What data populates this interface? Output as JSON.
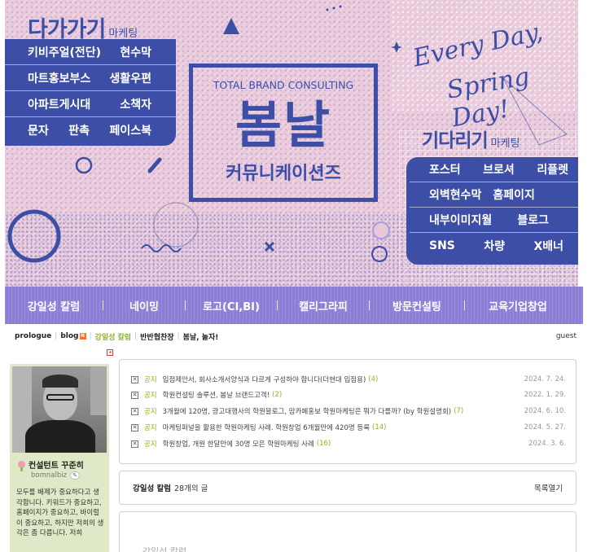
{
  "banner": {
    "left_title": "다가가기",
    "left_sub": "마케팅",
    "left_rows": [
      [
        "키비주얼(전단)",
        "현수막"
      ],
      [
        "마트홍보부스",
        "생활우편"
      ],
      [
        "아파트게시대",
        "소책자"
      ],
      [
        "문자",
        "판촉",
        "페이스북"
      ]
    ],
    "right_title": "기다리기",
    "right_sub": "마케팅",
    "right_rows": [
      [
        "포스터",
        "브로셔",
        "리플렛"
      ],
      [
        "외벽현수막",
        "홈페이지"
      ],
      [
        "내부이미지월",
        "블로그"
      ],
      [
        "SNS",
        "차량",
        "X배너"
      ]
    ],
    "logo_sub": "TOTAL BRAND CONSULTING",
    "logo_main": "봄날",
    "logo_comm": "커뮤니케이션즈",
    "script_line1": "Every Day,",
    "script_line2": "Spring Day!",
    "accent_color": "#3d4ea6",
    "nav": [
      "강일성 칼럼",
      "네이밍",
      "로고(CI,BI)",
      "캘리그라피",
      "방문컨설팅",
      "교육기업창업"
    ]
  },
  "blogmenu": {
    "items": [
      "prologue",
      "blog",
      "강일성 칼럼",
      "반반협찬장",
      "봄날, 놀자!"
    ],
    "new_badge": "N",
    "guest": "guest"
  },
  "profile": {
    "name": "컨설턴트 꾸준히",
    "id": "bomnalbiz",
    "edit": "✎",
    "desc": "모두를 배제가 중요하다고 생각합니다. 키워드가 중요하고, 홈페이지가 중요하고, 바이럴이 중요하고, 하지만 저희의 생각은 좀 다릅니다. 저희"
  },
  "notice": {
    "tag": "공지",
    "rows": [
      {
        "title": "입점제안서, 회사소개서양식과 다르게 구성하야 합니다(더현대 입점용)",
        "count": "(4)",
        "date": "2024. 7. 24."
      },
      {
        "title": "학원컨설팅 솔루션, 봄날 브랜드고객! ",
        "count": "(2)",
        "date": "2022. 1. 29."
      },
      {
        "title": "3개월에 120명, 광고대행사의 학원블로그, 맘카페홍보 학원마케팅은 뭐가 다를까? (by 학원설명회)",
        "count": "(7)",
        "date": "2024. 6. 10."
      },
      {
        "title": "마케팅퍼널을 활용한 학원마케팅 사례. 학원창업 6개월만에 420명 등록",
        "count": "(14)",
        "date": "2024. 5. 27."
      },
      {
        "title": "학원창업, 개원 한달만에 30명 모은 학원마케팅 사례",
        "count": "(16)",
        "date": "2024. 3. 6."
      }
    ]
  },
  "list": {
    "category": "강일성 칼럼",
    "count": "28개의 글",
    "open": "목록열기"
  },
  "post": {
    "title": "강일성 칼럼"
  }
}
